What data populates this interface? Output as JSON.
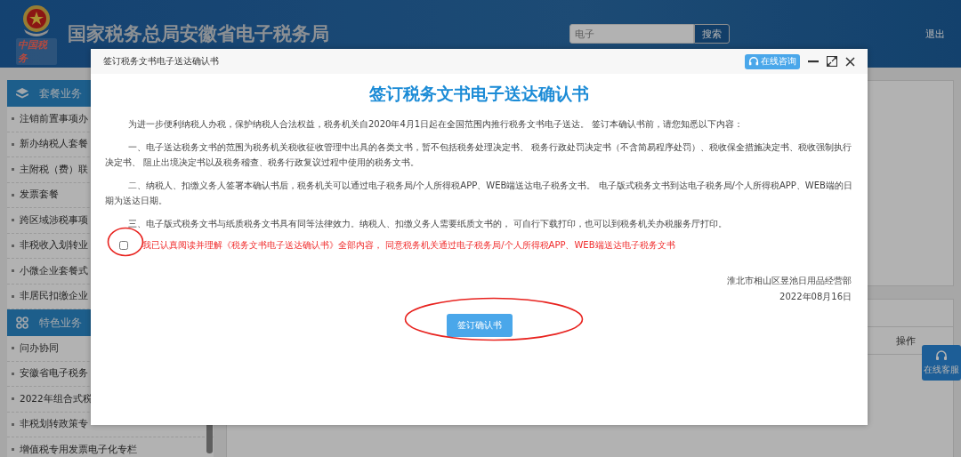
{
  "header": {
    "logo_caption": "中国税务",
    "title": "国家税务总局安徽省电子税务局",
    "search": {
      "value": "电子",
      "button": "搜索"
    },
    "logout": "退出"
  },
  "sidebar": [
    {
      "title": "套餐业务",
      "items": [
        "注销前置事项办",
        "新办纳税人套餐",
        "主附税（费）联",
        "发票套餐",
        "跨区域涉税事项",
        "非税收入划转业",
        "小微企业套餐式",
        "非居民扣缴企业"
      ]
    },
    {
      "title": "特色业务",
      "items": [
        "问办协同",
        "安徽省电子税务",
        "2022年组合式税",
        "非税划转政策专",
        "增值税专用发票电子化专栏"
      ]
    }
  ],
  "background_table": {
    "column": "操作"
  },
  "float_service": "在线客服",
  "dialog": {
    "title": "签订税务文书电子送达确认书",
    "consult_button": "在线咨询",
    "heading": "签订税务文书电子送达确认书",
    "paragraphs": [
      "为进一步便利纳税人办税，保护纳税人合法权益，税务机关自2020年4月1日起在全国范围内推行税务文书电子送达。 签订本确认书前，请您知悉以下内容：",
      "一、电子送达税务文书的范围为税务机关税收征收管理中出具的各类文书，暂不包括税务处理决定书、 税务行政处罚决定书（不含简易程序处罚）、税收保全措施决定书、税收强制执行决定书、 阻止出境决定书以及税务稽查、税务行政复议过程中使用的税务文书。",
      "二、纳税人、扣缴义务人签署本确认书后，税务机关可以通过电子税务局/个人所得税APP、WEB端送达电子税务文书。 电子版式税务文书到达电子税务局/个人所得税APP、WEB端的日期为送达日期。",
      "三、电子版式税务文书与纸质税务文书具有同等法律效力。纳税人、扣缴义务人需要纸质文书的， 可自行下载打印，也可以到税务机关办税服务厅打印。"
    ],
    "agreement": {
      "checked": false,
      "text": "我已认真阅读并理解《税务文书电子送达确认书》全部内容， 同意税务机关通过电子税务局/个人所得税APP、WEB端送达电子税务文书"
    },
    "signer": "淮北市相山区昱池日用品经营部",
    "date": "2022年08月16日",
    "sign_button": "签订确认书"
  }
}
